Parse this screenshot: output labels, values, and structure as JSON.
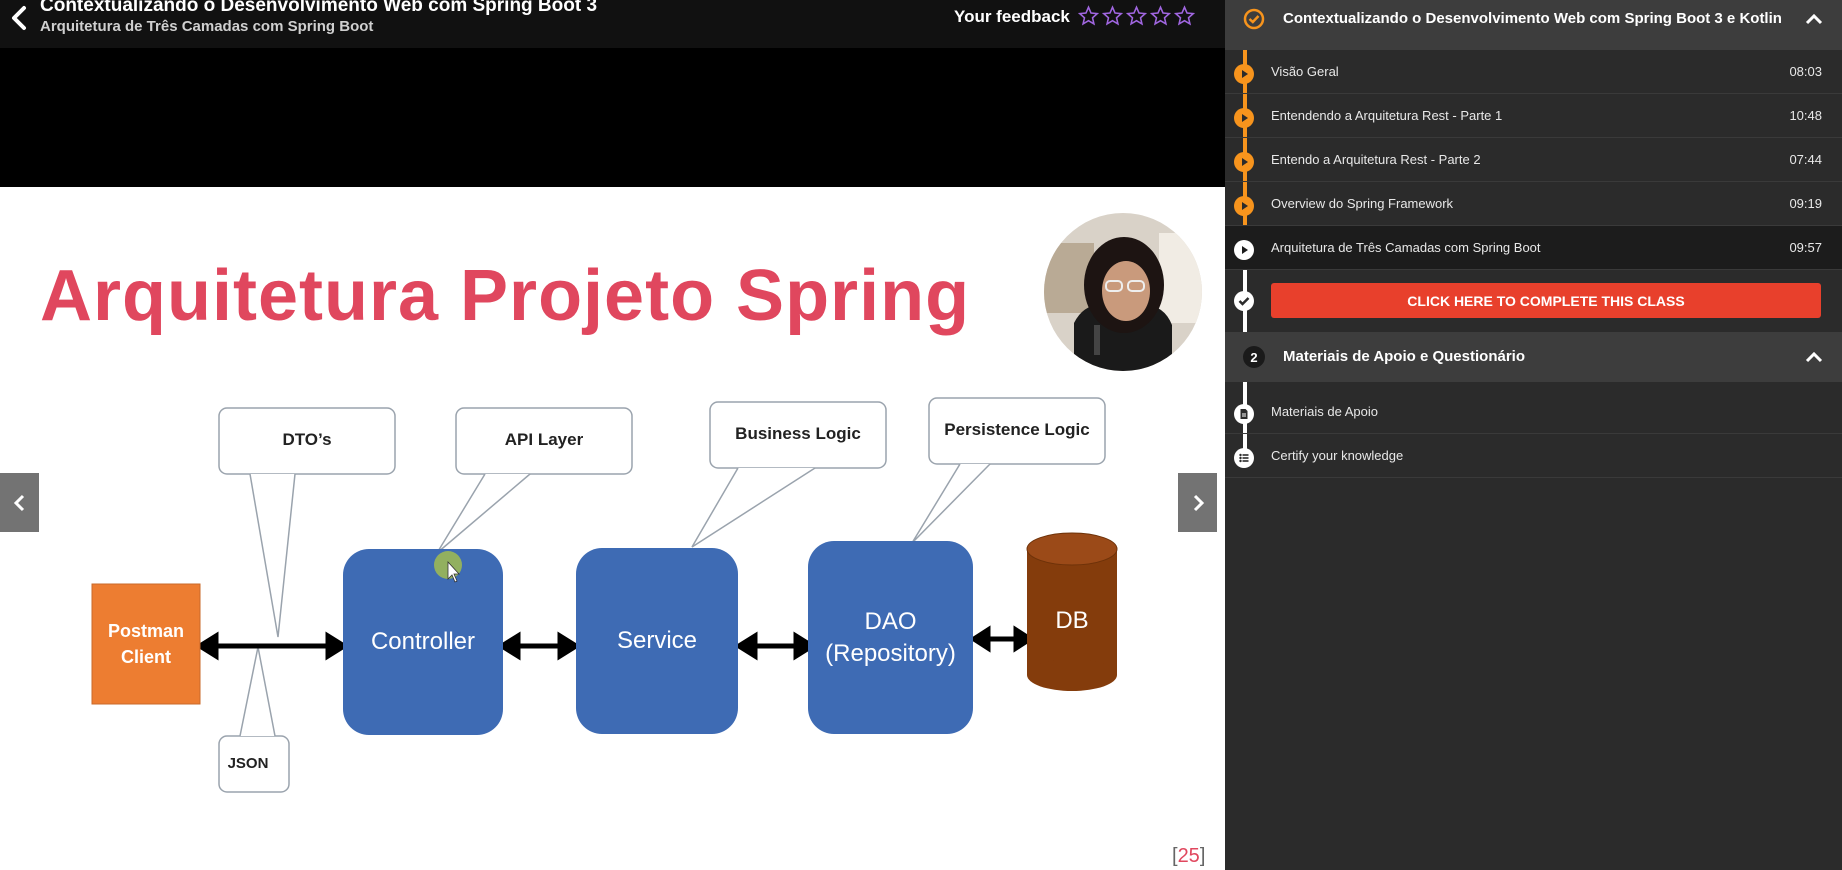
{
  "header": {
    "course_title": "Contextualizando o Desenvolvimento Web com Spring Boot 3",
    "lesson_subtitle": "Arquitetura de Três Camadas com Spring Boot",
    "feedback_label": "Your feedback",
    "rating": {
      "value": 0,
      "max": 5
    }
  },
  "slide": {
    "title": "Arquitetura Projeto Spring",
    "page_number": "25",
    "bracket_open": "[",
    "bracket_close": "]",
    "client_box": "Postman Client",
    "controller_box": "Controller",
    "service_box": "Service",
    "dao_box": "DAO (Repository)",
    "db_box": "DB",
    "callouts": {
      "dtos": "DTO’s",
      "api_layer": "API Layer",
      "business_logic": "Business Logic",
      "persistence_logic": "Persistence Logic",
      "json": "JSON"
    }
  },
  "sidebar": {
    "section1": {
      "title": "Contextualizando o Desenvolvimento Web com Spring Boot 3 e Kotlin",
      "lessons": [
        {
          "name": "Visão Geral",
          "duration": "08:03"
        },
        {
          "name": "Entendendo a Arquitetura Rest - Parte 1",
          "duration": "10:48"
        },
        {
          "name": "Entendo a Arquitetura Rest - Parte 2",
          "duration": "07:44"
        },
        {
          "name": "Overview do Spring Framework",
          "duration": "09:19"
        },
        {
          "name": "Arquitetura de Três Camadas com Spring Boot",
          "duration": "09:57"
        }
      ],
      "complete_button": "CLICK HERE TO COMPLETE THIS CLASS"
    },
    "section2": {
      "number": "2",
      "title": "Materiais de Apoio e Questionário",
      "items": [
        {
          "name": "Materiais de Apoio"
        },
        {
          "name": "Certify your knowledge"
        }
      ]
    }
  },
  "colors": {
    "accent_orange": "#f7941d",
    "complete_red": "#e8402c",
    "slide_title_red": "#e0475e",
    "box_blue": "#3e6bb4",
    "client_orange": "#ed7d31",
    "db_brown": "#843c0c"
  }
}
